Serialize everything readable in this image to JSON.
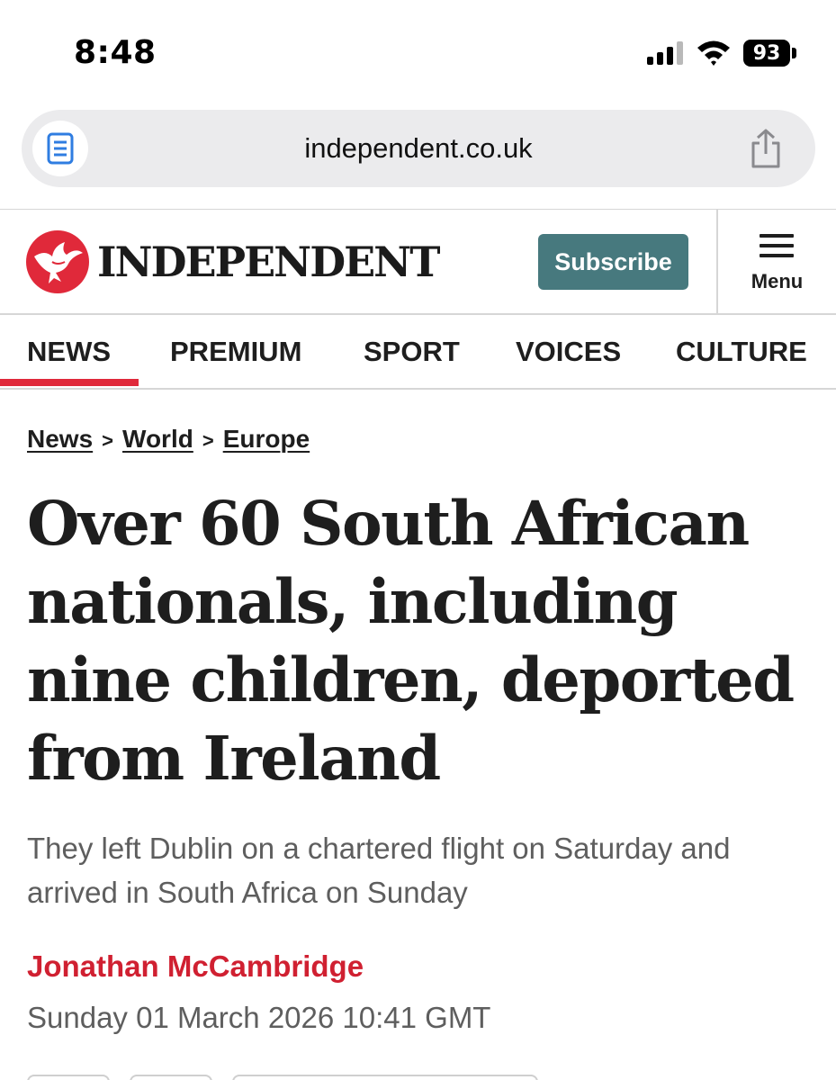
{
  "status_bar": {
    "time": "8:48",
    "battery": "93"
  },
  "browser": {
    "url": "independent.co.uk"
  },
  "header": {
    "logo_text": "INDEPENDENT",
    "subscribe_label": "Subscribe",
    "menu_label": "Menu"
  },
  "nav": {
    "items": [
      {
        "label": "NEWS",
        "active": true
      },
      {
        "label": "PREMIUM"
      },
      {
        "label": "SPORT"
      },
      {
        "label": "VOICES"
      },
      {
        "label": "CULTURE"
      }
    ]
  },
  "article": {
    "breadcrumb": [
      "News",
      "World",
      "Europe"
    ],
    "breadcrumb_separator": ">",
    "headline": "Over 60 South African nationals, including nine children, deported from Ireland",
    "standfirst": "They left Dublin on a chartered flight on Saturday and arrived in South Africa on Sunday",
    "author": "Jonathan McCambridge",
    "date": "Sunday 01 March 2026 10:41 GMT"
  },
  "colors": {
    "subscribe_bg": "#47797e",
    "brand_red": "#e0293a",
    "author_red": "#d02031"
  },
  "icons": {
    "reader": "reader-icon",
    "share": "share-icon",
    "logo": "eagle-logo-icon",
    "menu": "hamburger-icon"
  }
}
